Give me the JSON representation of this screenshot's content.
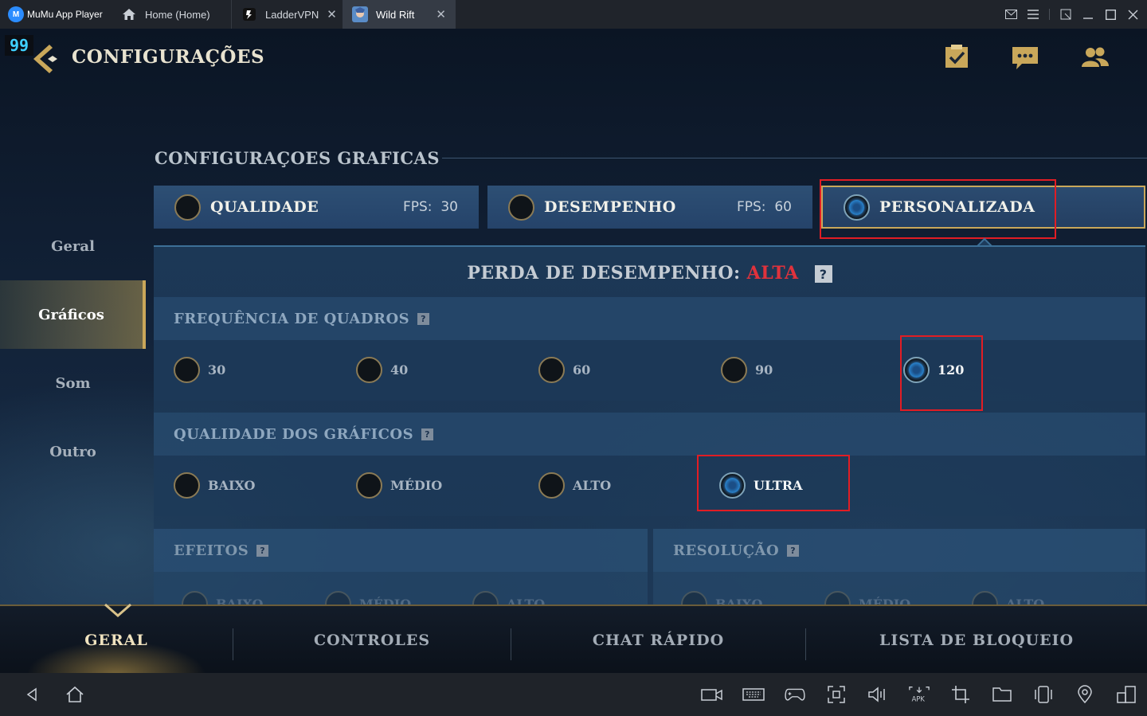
{
  "titlebar": {
    "app_name": "MuMu App Player",
    "tabs": [
      {
        "label": "Home (Home)"
      },
      {
        "label": "LadderVPN"
      },
      {
        "label": "Wild Rift"
      }
    ]
  },
  "game": {
    "fps_badge": "99",
    "title": "CONFIGURAÇÕES",
    "side_nav": [
      {
        "label": "Geral"
      },
      {
        "label": "Gráficos"
      },
      {
        "label": "Som"
      },
      {
        "label": "Outro"
      }
    ],
    "section_title": "CONFIGURAÇOES GRAFICAS",
    "presets": [
      {
        "label": "QUALIDADE",
        "fps_label": "FPS:",
        "fps_value": "30"
      },
      {
        "label": "DESEMPENHO",
        "fps_label": "FPS:",
        "fps_value": "60"
      },
      {
        "label": "PERSONALIZADA"
      }
    ],
    "perda": {
      "label": "PERDA DE DESEMPENHO:",
      "value": "ALTA"
    },
    "help_glyph": "?",
    "frame_rate": {
      "title": "FREQUÊNCIA DE QUADROS",
      "options": [
        "30",
        "40",
        "60",
        "90",
        "120"
      ],
      "selected": "120"
    },
    "graphics_quality": {
      "title": "QUALIDADE DOS GRÁFICOS",
      "options": [
        "BAIXO",
        "MÉDIO",
        "ALTO",
        "ULTRA"
      ],
      "selected": "ULTRA"
    },
    "effects": {
      "title": "EFEITOS",
      "options": [
        "BAIXO",
        "MÉDIO",
        "ALTO"
      ]
    },
    "resolution": {
      "title": "RESOLUÇÃO",
      "options": [
        "BAIXO",
        "MÉDIO",
        "ALTO"
      ]
    },
    "bottom_nav": [
      {
        "label": "GERAL"
      },
      {
        "label": "CONTROLES"
      },
      {
        "label": "CHAT RÁPIDO"
      },
      {
        "label": "LISTA DE BLOQUEIO"
      }
    ]
  },
  "colors": {
    "accent_gold": "#c9a75a",
    "alert_red": "#e0323c",
    "highlight_box": "#e11d24"
  }
}
